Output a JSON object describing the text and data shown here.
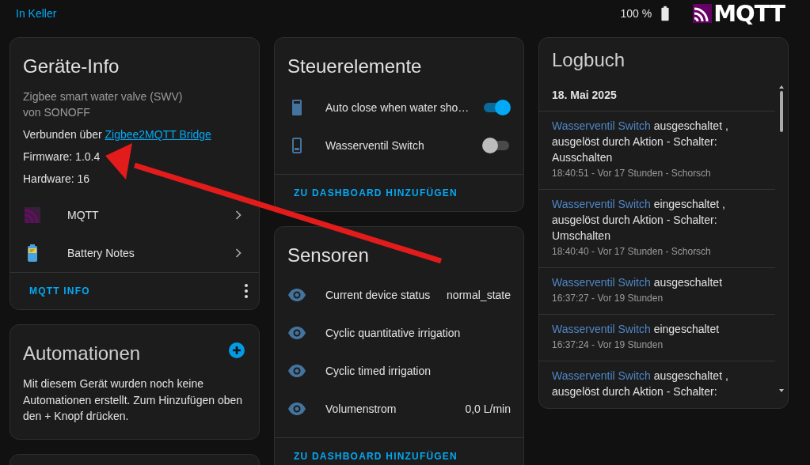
{
  "top_bar": {
    "area_link": "In Keller",
    "battery": "100 %",
    "logo_text": "MQTT"
  },
  "device_info": {
    "title": "Geräte-Info",
    "model": "Zigbee smart water valve (SWV)",
    "manufacturer": "von SONOFF",
    "connected_prefix": "Verbunden über",
    "connected_link": "Zigbee2MQTT Bridge",
    "firmware": "Firmware: 1.0.4",
    "hardware": "Hardware: 16",
    "integrations": [
      {
        "kind": "mqtt",
        "label": "MQTT"
      },
      {
        "kind": "battery",
        "label": "Battery Notes"
      }
    ],
    "action": "MQTT INFO"
  },
  "automations": {
    "title": "Automationen",
    "message": "Mit diesem Gerät wurden noch keine Automationen erstellt. Zum Hinzufügen oben den + Knopf drücken."
  },
  "controls": {
    "title": "Steuerelemente",
    "items": [
      {
        "kind": "filled",
        "label": "Auto close when water sho…",
        "on": true
      },
      {
        "kind": "outline",
        "label": "Wasserventil Switch",
        "on": false
      }
    ],
    "action": "ZU DASHBOARD HINZUFÜGEN"
  },
  "sensors": {
    "title": "Sensoren",
    "items": [
      {
        "label": "Current device status",
        "value": "normal_state"
      },
      {
        "label": "Cyclic quantitative irrigation"
      },
      {
        "label": "Cyclic timed irrigation"
      },
      {
        "label": "Volumenstrom",
        "value": "0,0 L/min"
      }
    ],
    "action": "ZU DASHBOARD HINZUFÜGEN"
  },
  "logbook": {
    "title": "Logbuch",
    "date": "18. Mai 2025",
    "entries": [
      {
        "entity": "Wasserventil Switch",
        "message": "ausgeschaltet , ausgelöst durch Aktion - Schalter: Ausschalten",
        "meta": "18:40:51 - Vor 17 Stunden - Schorsch"
      },
      {
        "entity": "Wasserventil Switch",
        "message": "eingeschaltet , ausgelöst durch Aktion - Schalter: Umschalten",
        "meta": "18:40:40 - Vor 17 Stunden - Schorsch"
      },
      {
        "entity": "Wasserventil Switch",
        "message": "ausgeschaltet",
        "meta": "16:37:27 - Vor 19 Stunden"
      },
      {
        "entity": "Wasserventil Switch",
        "message": "eingeschaltet",
        "meta": "16:37:24 - Vor 19 Stunden"
      },
      {
        "entity": "Wasserventil Switch",
        "message": "ausgeschaltet , ausgelöst durch Aktion - Schalter:"
      }
    ]
  }
}
